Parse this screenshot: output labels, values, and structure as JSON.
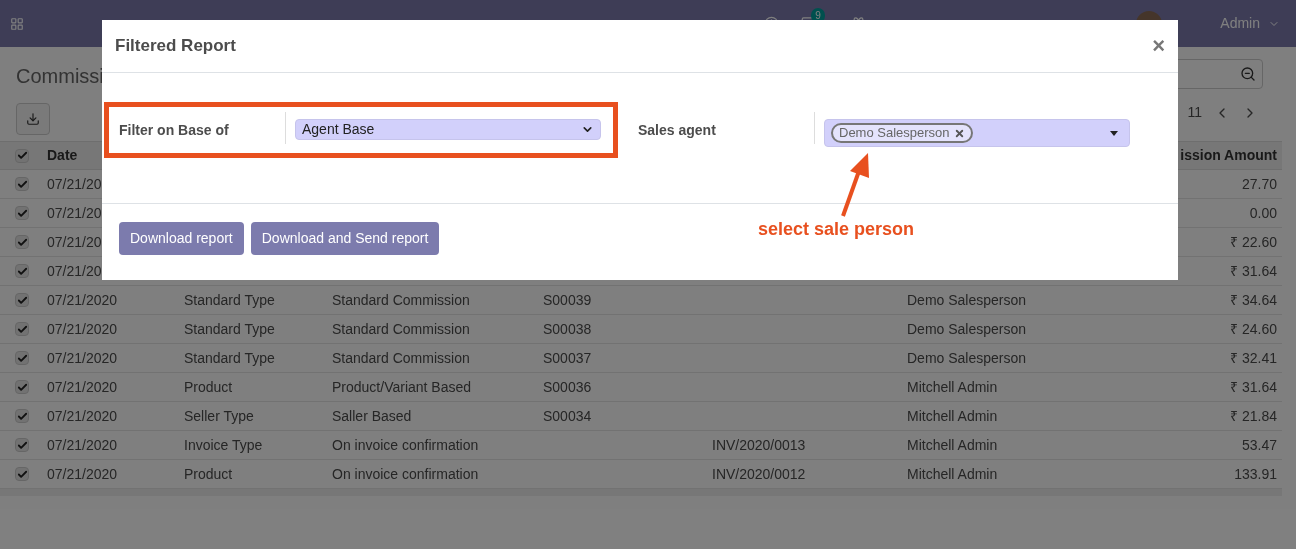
{
  "navbar": {
    "messages_count": "9",
    "user": "Admin"
  },
  "control_panel": {
    "title": "Commissi",
    "pager": "11"
  },
  "table": {
    "header_checked": true,
    "columns": [
      "Date",
      "ission Amount"
    ],
    "rows": [
      {
        "checked": true,
        "date": "07/21/20",
        "amount": "27.70"
      },
      {
        "checked": true,
        "date": "07/21/20",
        "amount": "0.00"
      },
      {
        "checked": true,
        "date": "07/21/20",
        "amount": "₹ 22.60"
      },
      {
        "checked": true,
        "date": "07/21/20",
        "amount": "₹ 31.64"
      },
      {
        "checked": true,
        "date": "07/21/2020",
        "type": "Standard Type",
        "rule": "Standard Commission",
        "order": "S00039",
        "agent": "Demo Salesperson",
        "amount": "₹ 34.64"
      },
      {
        "checked": true,
        "date": "07/21/2020",
        "type": "Standard Type",
        "rule": "Standard Commission",
        "order": "S00038",
        "agent": "Demo Salesperson",
        "amount": "₹ 24.60"
      },
      {
        "checked": true,
        "date": "07/21/2020",
        "type": "Standard Type",
        "rule": "Standard Commission",
        "order": "S00037",
        "agent": "Demo Salesperson",
        "amount": "₹ 32.41"
      },
      {
        "checked": true,
        "date": "07/21/2020",
        "type": "Product",
        "rule": "Product/Variant Based",
        "order": "S00036",
        "agent": "Mitchell Admin",
        "amount": "₹ 31.64"
      },
      {
        "checked": true,
        "date": "07/21/2020",
        "type": "Seller Type",
        "rule": "Saller Based",
        "order": "S00034",
        "agent": "Mitchell Admin",
        "amount": "₹ 21.84"
      },
      {
        "checked": true,
        "date": "07/21/2020",
        "type": "Invoice Type",
        "rule": "On invoice confirmation",
        "invoice": "INV/2020/0013",
        "agent": "Mitchell Admin",
        "amount": "53.47"
      },
      {
        "checked": true,
        "date": "07/21/2020",
        "type": "Product",
        "rule": "On invoice confirmation",
        "invoice": "INV/2020/0012",
        "agent": "Mitchell Admin",
        "amount": "133.91"
      }
    ]
  },
  "dialog": {
    "title": "Filtered Report",
    "close": "×",
    "fields": [
      {
        "label": "Filter on Base of",
        "kind": "select",
        "value": "Agent Base",
        "highlighted": true
      },
      {
        "label": "Sales agent",
        "kind": "tags",
        "tags": [
          "Demo Salesperson"
        ],
        "highlighted": false
      }
    ],
    "buttons": [
      "Download report",
      "Download and Send report"
    ],
    "annotation": "select sale person"
  }
}
